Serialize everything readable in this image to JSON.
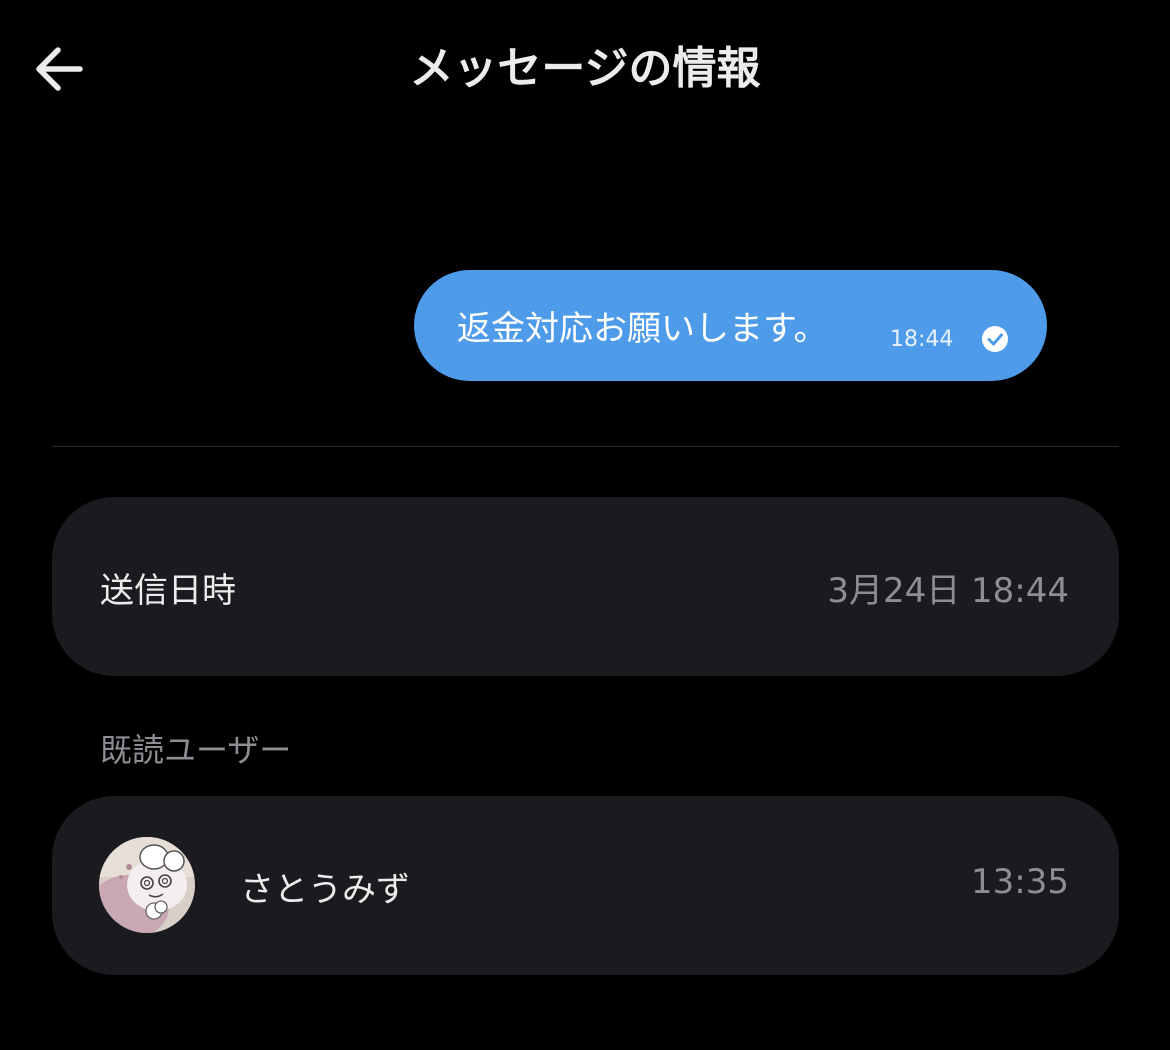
{
  "header": {
    "back_icon": "arrow-left-icon",
    "title": "メッセージの情報"
  },
  "message": {
    "text": "返金対応お願いします。",
    "time": "18:44",
    "status_icon": "check-circle-icon",
    "bubble_color": "#4d9be9"
  },
  "sent_info": {
    "label": "送信日時",
    "value": "3月24日 18:44"
  },
  "readers": {
    "section_label": "既読ユーザー",
    "items": [
      {
        "name": "さとうみず",
        "time": "13:35"
      }
    ]
  },
  "colors": {
    "background": "#000000",
    "card": "#1b1b1f",
    "secondary_text": "#8d8d93"
  }
}
